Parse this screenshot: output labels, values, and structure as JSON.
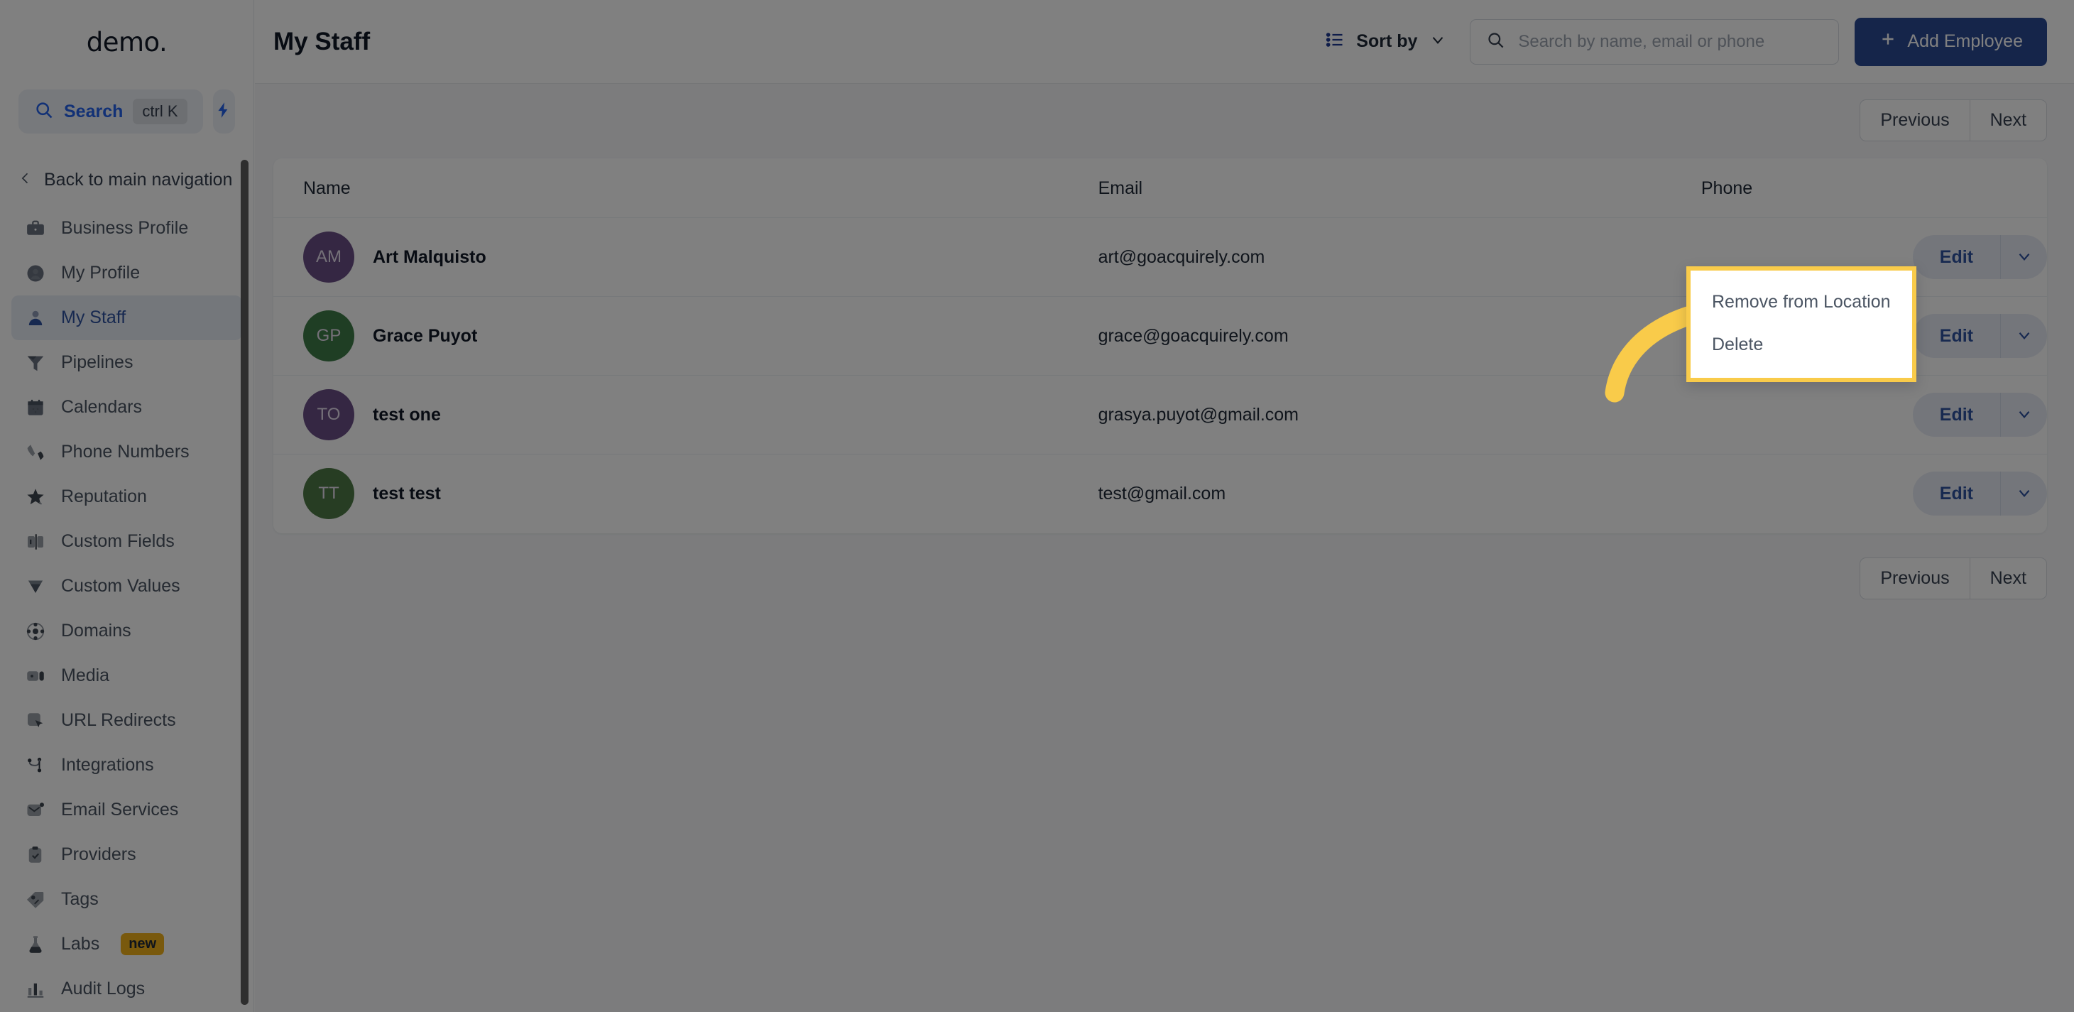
{
  "colors": {
    "accent_blue": "#2563eb",
    "brand_button": "#2b4a94",
    "active_nav_bg": "#e8edf6",
    "active_nav_text": "#2f52a0",
    "highlight_yellow": "#f9cb4a",
    "badge_new_bg": "#f1b11b",
    "avatar_purple": "#6b4f86",
    "avatar_green": "#3f7d48"
  },
  "sidebar": {
    "brand": "demo.",
    "search": {
      "label": "Search",
      "shortcut": "ctrl K",
      "icon": "search-icon"
    },
    "quick_action_icon": "lightning-bolt-icon",
    "back_link": {
      "label": "Back to main navigation",
      "icon": "chevron-left-icon"
    },
    "items": [
      {
        "label": "Business Profile",
        "icon": "briefcase-icon",
        "active": false,
        "badge": ""
      },
      {
        "label": "My Profile",
        "icon": "user-circle-icon",
        "active": false,
        "badge": ""
      },
      {
        "label": "My Staff",
        "icon": "user-icon",
        "active": true,
        "badge": ""
      },
      {
        "label": "Pipelines",
        "icon": "funnel-icon",
        "active": false,
        "badge": ""
      },
      {
        "label": "Calendars",
        "icon": "calendar-icon",
        "active": false,
        "badge": ""
      },
      {
        "label": "Phone Numbers",
        "icon": "phone-icon",
        "active": false,
        "badge": ""
      },
      {
        "label": "Reputation",
        "icon": "star-icon",
        "active": false,
        "badge": ""
      },
      {
        "label": "Custom Fields",
        "icon": "fields-icon",
        "active": false,
        "badge": ""
      },
      {
        "label": "Custom Values",
        "icon": "diamond-icon",
        "active": false,
        "badge": ""
      },
      {
        "label": "Domains",
        "icon": "globe-icon",
        "active": false,
        "badge": ""
      },
      {
        "label": "Media",
        "icon": "video-icon",
        "active": false,
        "badge": ""
      },
      {
        "label": "URL Redirects",
        "icon": "cursor-box-icon",
        "active": false,
        "badge": ""
      },
      {
        "label": "Integrations",
        "icon": "nodes-icon",
        "active": false,
        "badge": ""
      },
      {
        "label": "Email Services",
        "icon": "envelope-icon",
        "active": false,
        "badge": ""
      },
      {
        "label": "Providers",
        "icon": "clipboard-check-icon",
        "active": false,
        "badge": ""
      },
      {
        "label": "Tags",
        "icon": "tag-icon",
        "active": false,
        "badge": ""
      },
      {
        "label": "Labs",
        "icon": "flask-icon",
        "active": false,
        "badge": "new"
      },
      {
        "label": "Audit Logs",
        "icon": "bar-chart-icon",
        "active": false,
        "badge": ""
      }
    ]
  },
  "topbar": {
    "title": "My Staff",
    "sort_by_label": "Sort by",
    "sort_by_icon": "list-icon",
    "sort_by_caret_icon": "chevron-down-icon",
    "search": {
      "placeholder": "Search by name, email or phone",
      "value": "",
      "icon": "search-icon"
    },
    "add_button": {
      "label": "Add Employee",
      "icon": "plus-icon"
    }
  },
  "pagination": {
    "previous": "Previous",
    "next": "Next"
  },
  "table": {
    "columns": {
      "name": "Name",
      "email": "Email",
      "phone": "Phone"
    },
    "rows": [
      {
        "initials": "AM",
        "avatar_color": "#6b4f86",
        "name": "Art Malquisto",
        "email": "art@goacquirely.com",
        "phone": "",
        "action_label": "Edit"
      },
      {
        "initials": "GP",
        "avatar_color": "#3f7d48",
        "name": "Grace Puyot",
        "email": "grace@goacquirely.com",
        "phone": "",
        "action_label": "Edit"
      },
      {
        "initials": "TO",
        "avatar_color": "#6b4f86",
        "name": "test one",
        "email": "grasya.puyot@gmail.com",
        "phone": "",
        "action_label": "Edit"
      },
      {
        "initials": "TT",
        "avatar_color": "#4e7a46",
        "name": "test test",
        "email": "test@gmail.com",
        "phone": "",
        "action_label": "Edit"
      }
    ]
  },
  "dropdown": {
    "items": [
      {
        "label": "Remove from Location"
      },
      {
        "label": "Delete"
      }
    ]
  },
  "annotation": {
    "type": "curved-arrow",
    "color": "#f9cb4a"
  }
}
